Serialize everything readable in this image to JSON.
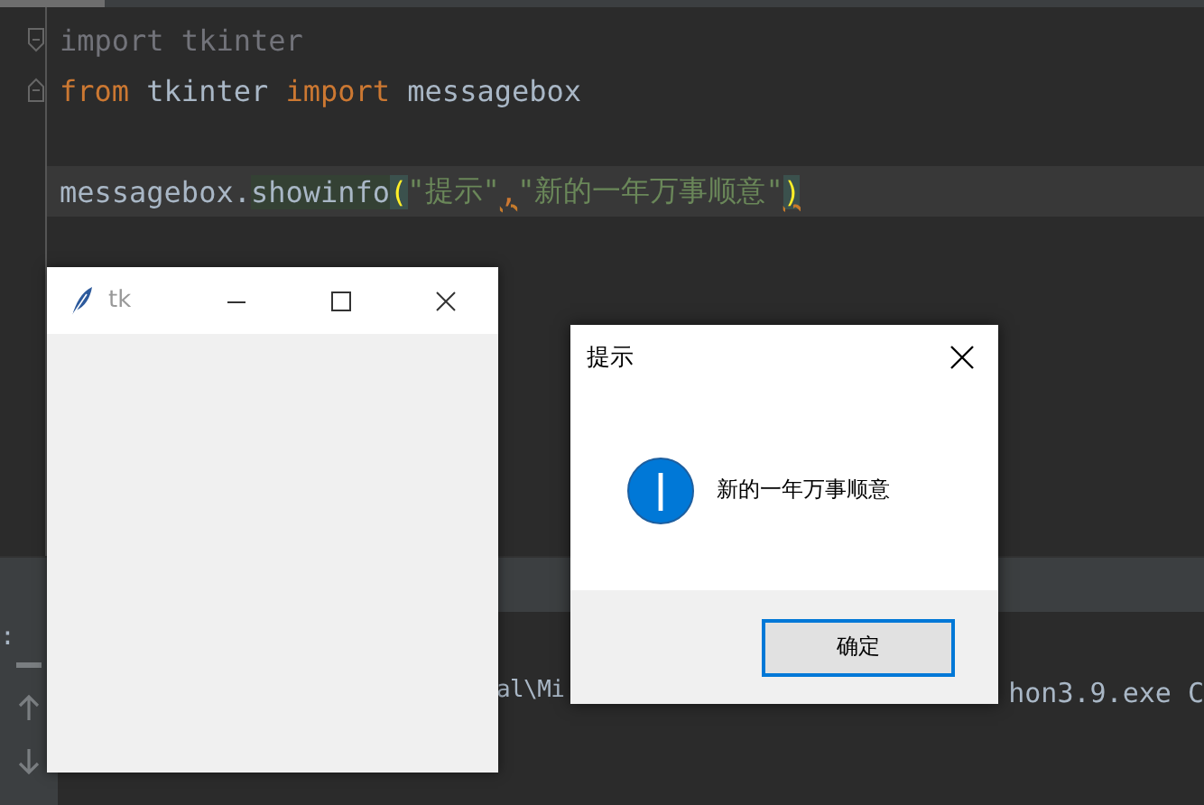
{
  "editor": {
    "lines": [
      {
        "kind": "code",
        "current": false,
        "tokens": [
          {
            "text": "import tkinter",
            "kind": "dim"
          }
        ]
      },
      {
        "kind": "code",
        "current": false,
        "tokens": [
          {
            "text": "from",
            "kind": "keyword"
          },
          {
            "text": " tkinter ",
            "kind": "name"
          },
          {
            "text": "import",
            "kind": "keyword"
          },
          {
            "text": " messagebox",
            "kind": "name"
          }
        ]
      },
      {
        "kind": "blank",
        "current": false
      },
      {
        "kind": "code",
        "current": true,
        "tokens": [
          {
            "text": "messagebox.",
            "kind": "name"
          },
          {
            "text": "showinfo",
            "kind": "method_hl"
          },
          {
            "text": "(",
            "kind": "brace"
          },
          {
            "text": "\"提示\"",
            "kind": "string"
          },
          {
            "text": ",",
            "kind": "warn"
          },
          {
            "text": "\"新的一年万事顺意\"",
            "kind": "string"
          },
          {
            "text": ")",
            "kind": "brace_warn"
          }
        ]
      }
    ]
  },
  "console": {
    "side_label": ":",
    "fragments": [
      "al\\Mi",
      "hon3.9.exe C"
    ]
  },
  "tk_window": {
    "title": "tk"
  },
  "dialog": {
    "title": "提示",
    "message": "新的一年万事顺意",
    "button": "确定"
  }
}
